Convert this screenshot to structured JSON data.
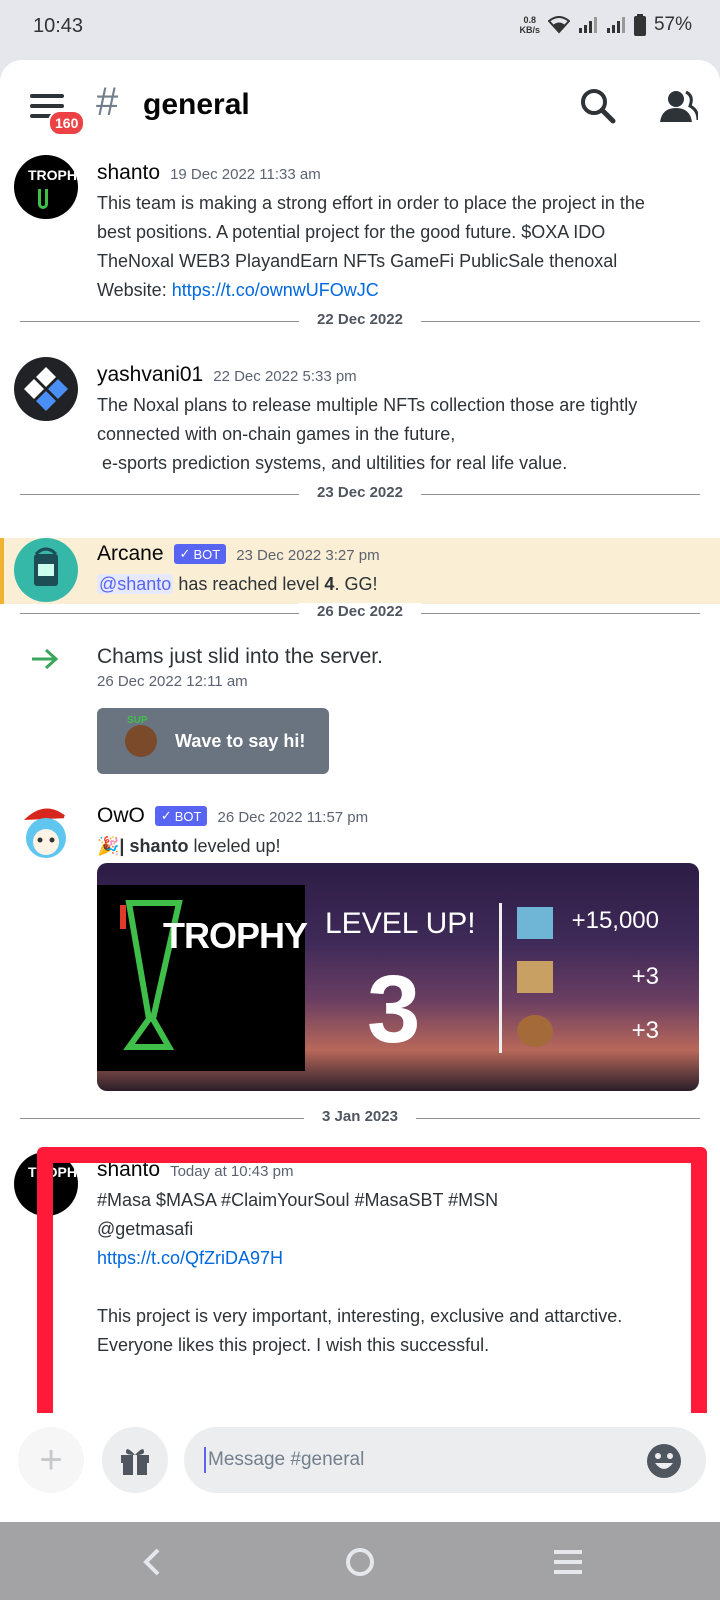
{
  "status": {
    "time": "10:43",
    "speed_value": "0.8",
    "speed_unit": "KB/s",
    "battery": "57%"
  },
  "header": {
    "hash": "#",
    "channel": "general",
    "unread_badge": "160"
  },
  "messages": [
    {
      "user": "shanto",
      "time": "19 Dec 2022 11:33 am",
      "line1": "This team is making a strong effort in order to place the project in the",
      "line2": "best positions. A potential project for the good future. $OXA IDO",
      "line3": "TheNoxal WEB3 PlayandEarn NFTs GameFi PublicSale thenoxal",
      "website_label": "Website: ",
      "link": "https://t.co/ownwUFOwJC",
      "avatar_text": "TROPHY"
    },
    {
      "user": "yashvani01",
      "time": "22 Dec 2022 5:33 pm",
      "line1": "The Noxal plans to release multiple NFTs collection those are tightly",
      "line2": "connected with on-chain games in the future,",
      "line3": " e-sports prediction systems, and ultilities for real life value."
    },
    {
      "user": "Arcane",
      "bot": "BOT",
      "time": "23 Dec 2022 3:27 pm",
      "mention": "@shanto",
      "text_a": " has reached level ",
      "level": "4",
      "text_b": ". GG!"
    },
    {
      "system_user": "Chams",
      "system_text": " just slid into the server.",
      "time": "26 Dec 2022 12:11 am",
      "wave_label": "Wave to say hi!",
      "wave_sticker": "SUP"
    },
    {
      "user": "OwO",
      "bot": "BOT",
      "time": "26 Dec 2022 11:57 pm",
      "prefix": "| ",
      "bold_user": "shanto",
      "text": " leveled up!",
      "card": {
        "trophy": "TROPHY",
        "level_up": "LEVEL UP!",
        "level": "3",
        "r1": "+15,000",
        "r2": "+3",
        "r3": "+3"
      }
    },
    {
      "user": "shanto",
      "time": "Today at 10:43 pm",
      "line1": "#Masa $MASA #ClaimYourSoul #MasaSBT #MSN",
      "line2": "@getmasafi",
      "link": "https://t.co/QfZriDA97H",
      "line4": "This project is very important, interesting, exclusive and attarctive.",
      "line5": "Everyone likes this project. I wish this successful.",
      "avatar_text": "TROPHY"
    }
  ],
  "dividers": [
    "22 Dec 2022",
    "23 Dec 2022",
    "26 Dec 2022",
    "3 Jan 2023"
  ],
  "composer": {
    "placeholder": "Message #general"
  },
  "colors": {
    "blurple": "#5865f2",
    "link": "#0068e0",
    "highlight": "#faeed4",
    "annotation_box": "#ff1a3a"
  }
}
